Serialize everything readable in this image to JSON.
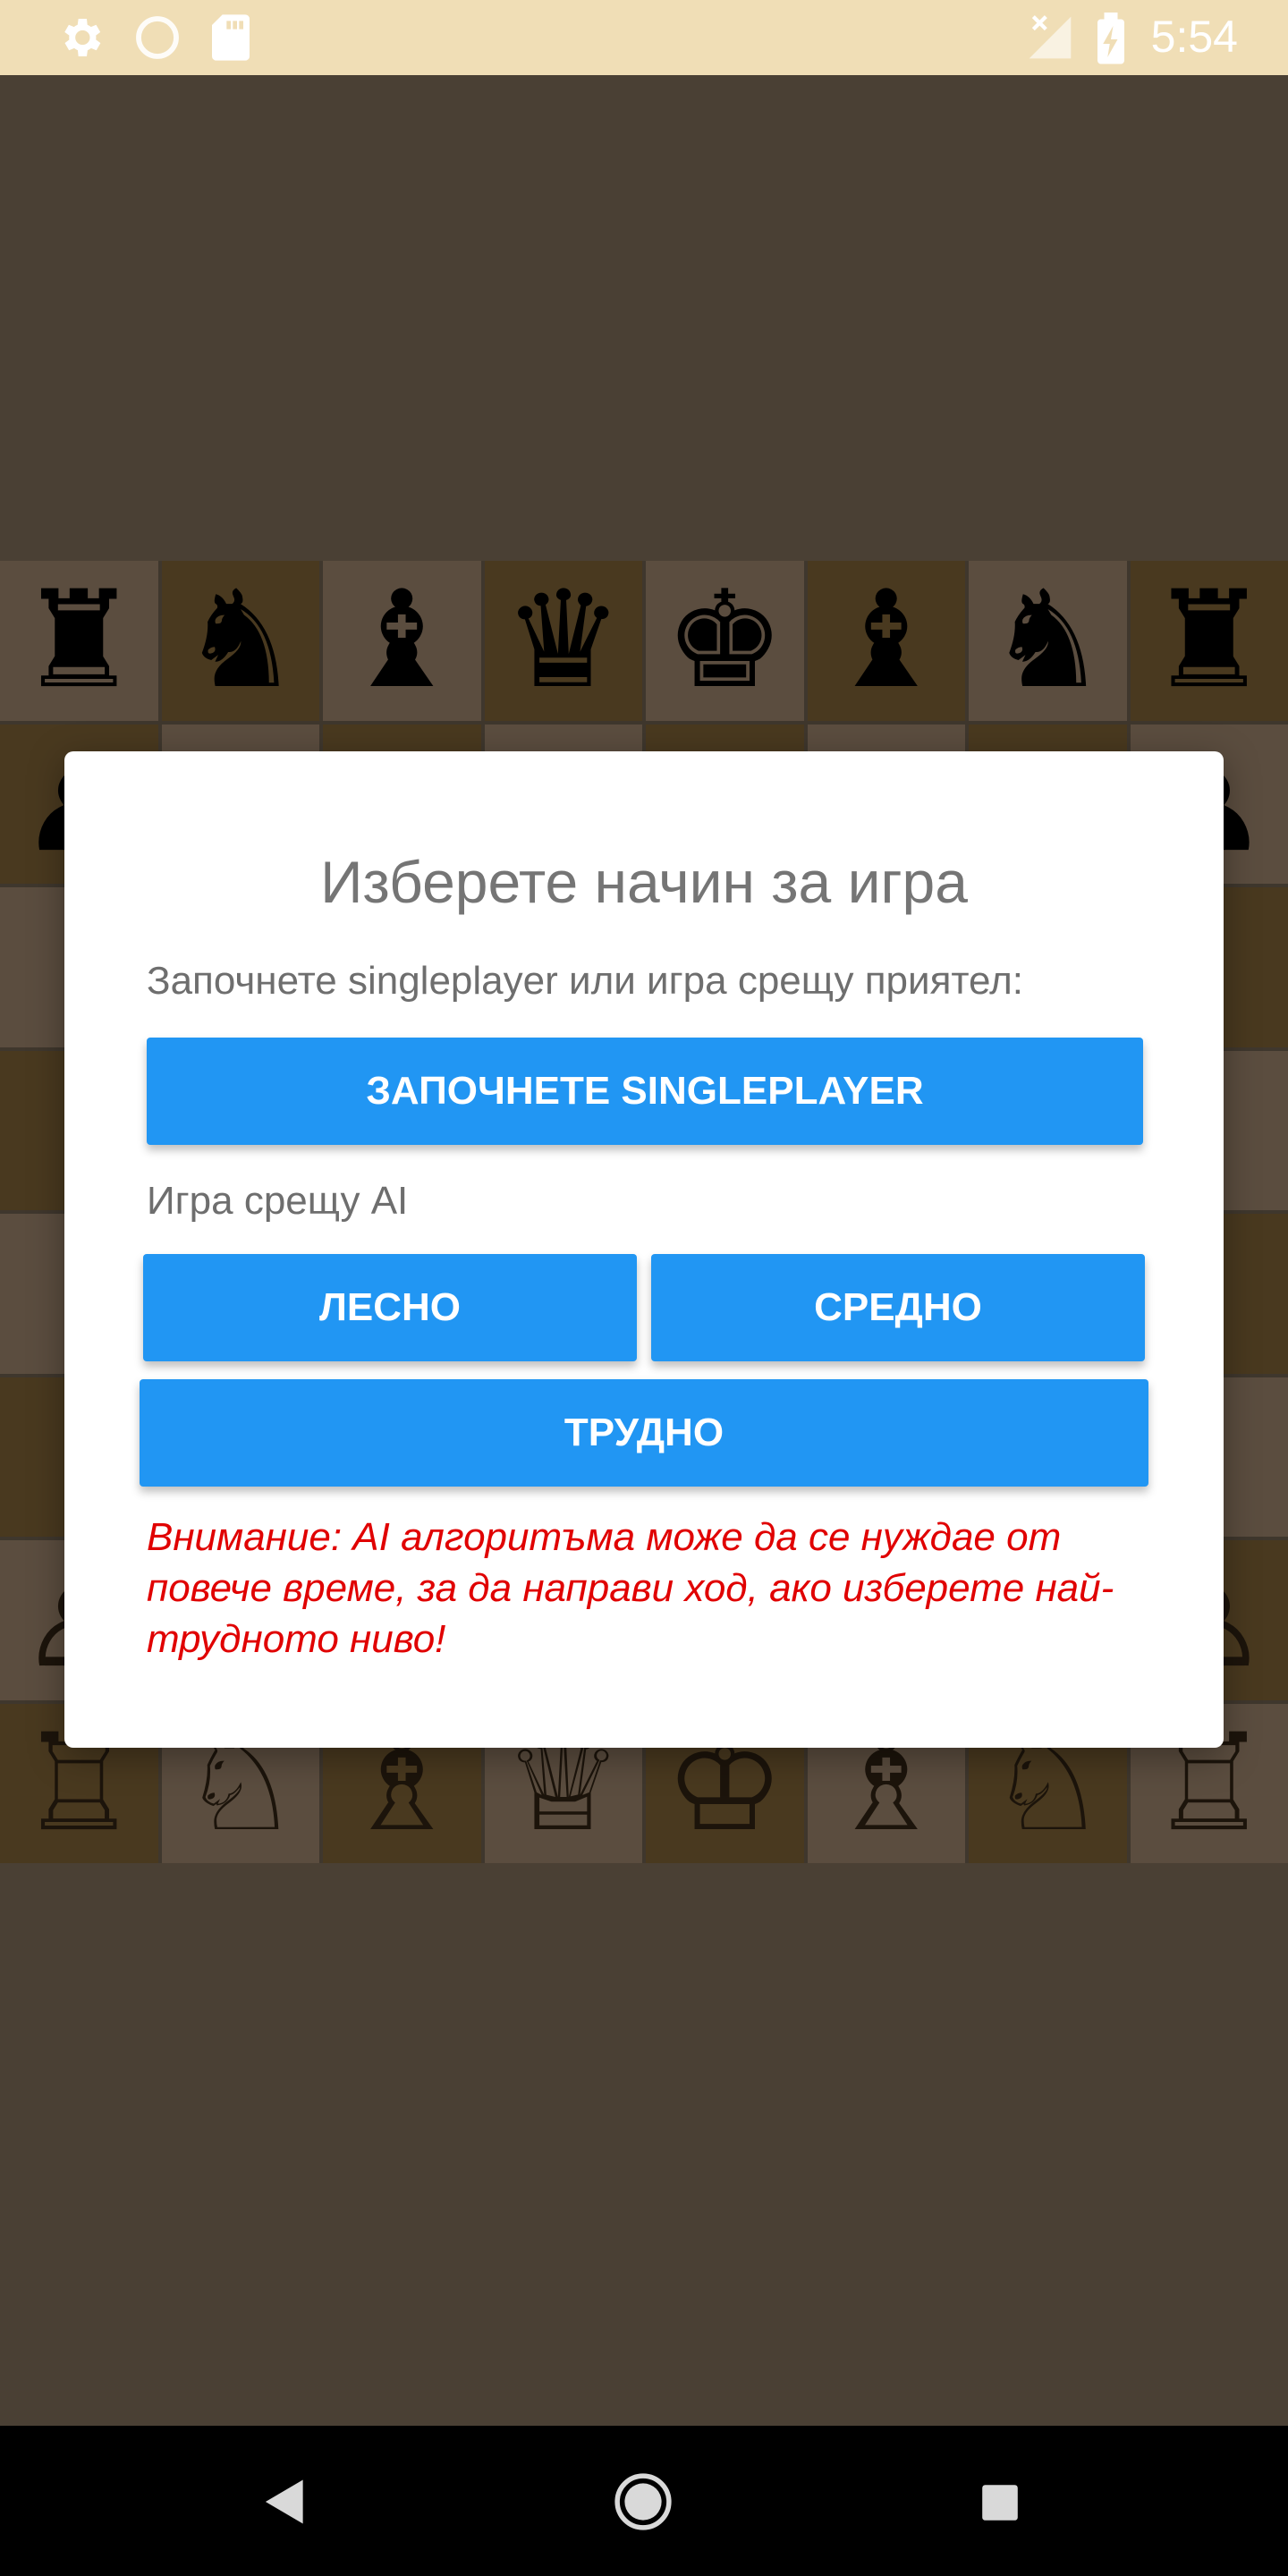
{
  "status_bar": {
    "time": "5:54",
    "icons": [
      "gear-icon",
      "circle-icon",
      "sd-card-icon",
      "signal-off-icon",
      "battery-charging-icon"
    ]
  },
  "board": {
    "rows": [
      [
        {
          "p": "♜",
          "c": "black"
        },
        {
          "p": "♞",
          "c": "black"
        },
        {
          "p": "♝",
          "c": "black"
        },
        {
          "p": "♛",
          "c": "black"
        },
        {
          "p": "♚",
          "c": "black"
        },
        {
          "p": "♝",
          "c": "black"
        },
        {
          "p": "♞",
          "c": "black"
        },
        {
          "p": "♜",
          "c": "black"
        }
      ],
      [
        {
          "p": "♟",
          "c": "black"
        },
        {
          "p": "♟",
          "c": "black"
        },
        {
          "p": "♟",
          "c": "black"
        },
        {
          "p": "♟",
          "c": "black"
        },
        {
          "p": "♟",
          "c": "black"
        },
        {
          "p": "♟",
          "c": "black"
        },
        {
          "p": "♟",
          "c": "black"
        },
        {
          "p": "♟",
          "c": "black"
        }
      ],
      [
        {
          "p": ""
        },
        {
          "p": ""
        },
        {
          "p": ""
        },
        {
          "p": ""
        },
        {
          "p": ""
        },
        {
          "p": ""
        },
        {
          "p": ""
        },
        {
          "p": ""
        }
      ],
      [
        {
          "p": ""
        },
        {
          "p": ""
        },
        {
          "p": ""
        },
        {
          "p": ""
        },
        {
          "p": ""
        },
        {
          "p": ""
        },
        {
          "p": ""
        },
        {
          "p": ""
        }
      ],
      [
        {
          "p": ""
        },
        {
          "p": ""
        },
        {
          "p": ""
        },
        {
          "p": ""
        },
        {
          "p": ""
        },
        {
          "p": ""
        },
        {
          "p": ""
        },
        {
          "p": ""
        }
      ],
      [
        {
          "p": ""
        },
        {
          "p": ""
        },
        {
          "p": ""
        },
        {
          "p": ""
        },
        {
          "p": ""
        },
        {
          "p": ""
        },
        {
          "p": ""
        },
        {
          "p": ""
        }
      ],
      [
        {
          "p": "♙",
          "c": "white"
        },
        {
          "p": "♙",
          "c": "white"
        },
        {
          "p": "♙",
          "c": "white"
        },
        {
          "p": "♙",
          "c": "white"
        },
        {
          "p": "♙",
          "c": "white"
        },
        {
          "p": "♙",
          "c": "white"
        },
        {
          "p": "♙",
          "c": "white"
        },
        {
          "p": "♙",
          "c": "white"
        }
      ],
      [
        {
          "p": "♖",
          "c": "white"
        },
        {
          "p": "♘",
          "c": "white"
        },
        {
          "p": "♗",
          "c": "white"
        },
        {
          "p": "♕",
          "c": "white"
        },
        {
          "p": "♔",
          "c": "white"
        },
        {
          "p": "♗",
          "c": "white"
        },
        {
          "p": "♘",
          "c": "white"
        },
        {
          "p": "♖",
          "c": "white"
        }
      ]
    ]
  },
  "dialog": {
    "title": "Изберете начин за игра",
    "subtitle": "Започнете singleplayer или игра срещу приятел:",
    "singleplayer_button": "ЗАПОЧНЕТЕ SINGLEPLAYER",
    "ai_label": "Игра срещу AI",
    "easy_button": "ЛЕСНО",
    "medium_button": "СРЕДНО",
    "hard_button": "ТРУДНО",
    "warning": "Внимание: AI алгоритъма може да се нуждае от повече време, за да направи ход, ако изберете най-трудното ниво!"
  },
  "nav_bar": {
    "icons": [
      "back-icon",
      "home-icon",
      "recents-icon"
    ]
  },
  "colors": {
    "accent": "#2196f3",
    "warning": "#e00000",
    "status_bar": "#f0deb6",
    "background": "#4a4034"
  }
}
